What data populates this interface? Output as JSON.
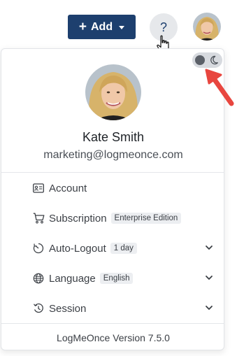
{
  "header": {
    "add_button_label": "Add",
    "add_button_icon": "plus-icon",
    "help_label": "?",
    "colors": {
      "primary": "#1d3f6e",
      "help_bg": "#e6e8eb"
    }
  },
  "profile": {
    "name": "Kate Smith",
    "email": "marketing@logmeonce.com"
  },
  "theme_toggle": {
    "mode": "light",
    "icon": "moon-icon"
  },
  "menu": [
    {
      "label": "Account",
      "icon": "id-card-icon",
      "badge": "",
      "expandable": false
    },
    {
      "label": "Subscription",
      "icon": "cart-icon",
      "badge": "Enterprise Edition",
      "expandable": false
    },
    {
      "label": "Auto-Logout",
      "icon": "timer-icon",
      "badge": "1 day",
      "expandable": true
    },
    {
      "label": "Language",
      "icon": "globe-icon",
      "badge": "English",
      "expandable": true
    },
    {
      "label": "Session",
      "icon": "history-icon",
      "badge": "",
      "expandable": true
    }
  ],
  "footer": {
    "version_text": "LogMeOnce Version 7.5.0"
  },
  "annotation": {
    "arrow_color": "#e8463f"
  }
}
